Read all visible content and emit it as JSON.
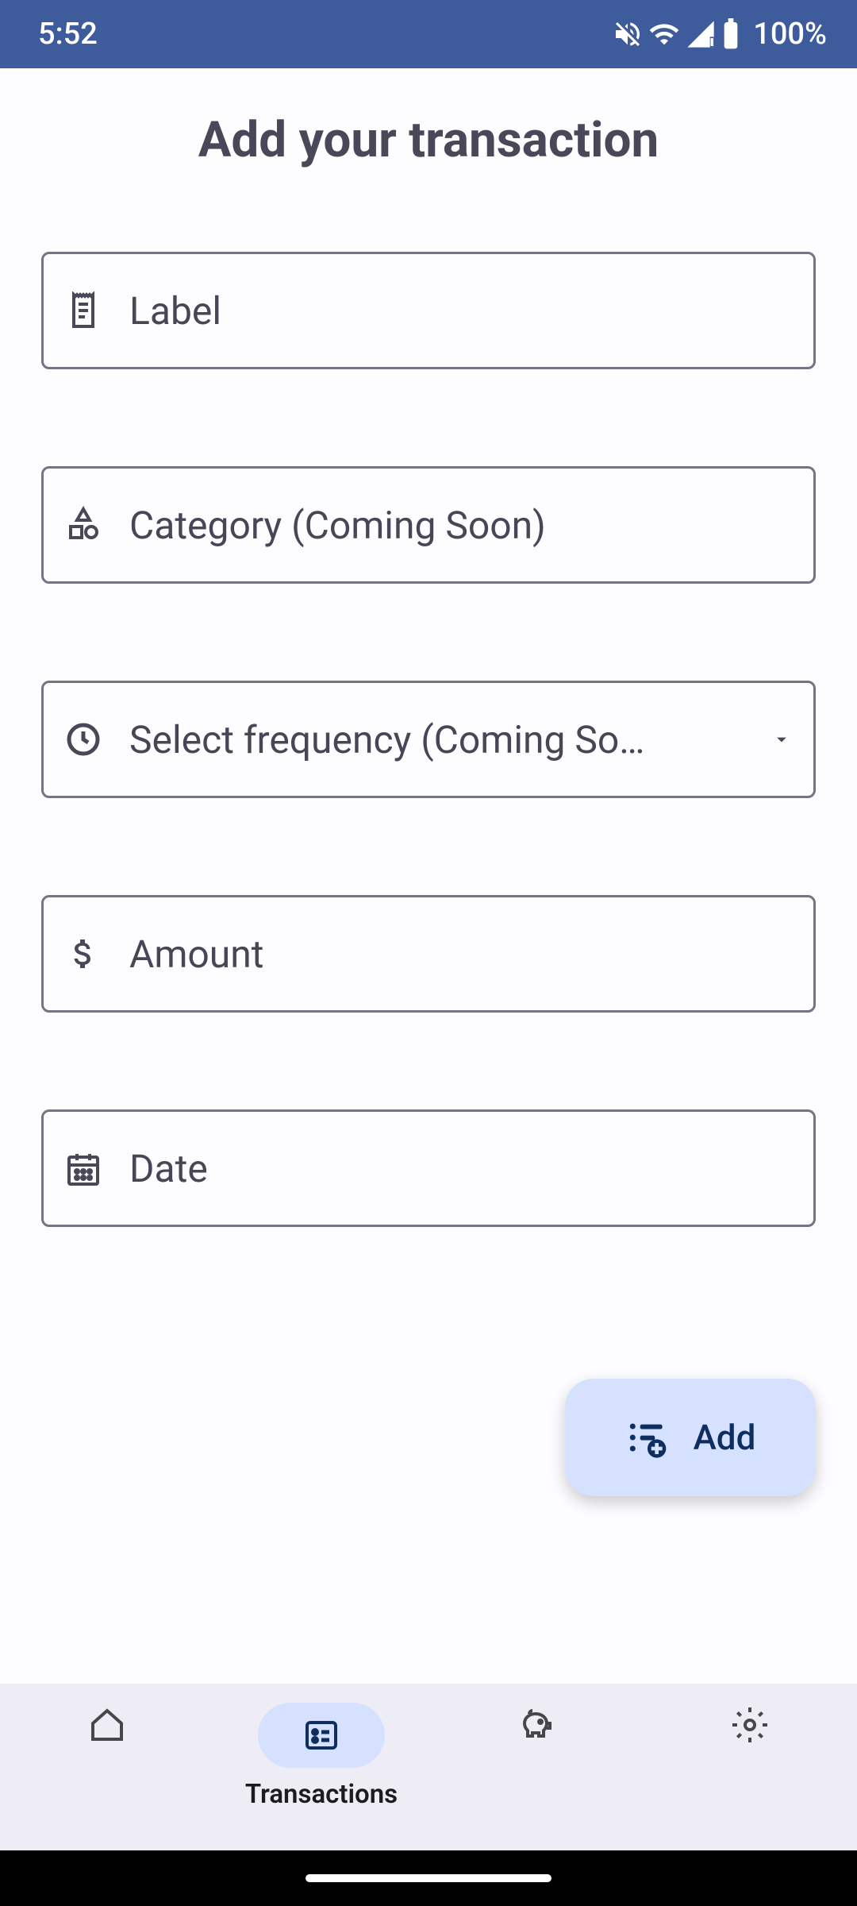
{
  "statusBar": {
    "time": "5:52",
    "battery": "100%"
  },
  "page": {
    "title": "Add your transaction"
  },
  "fields": {
    "label": {
      "placeholder": "Label"
    },
    "category": {
      "placeholder": "Category (Coming Soon)"
    },
    "frequency": {
      "placeholder": "Select frequency (Coming So…"
    },
    "amount": {
      "placeholder": "Amount"
    },
    "date": {
      "placeholder": "Date"
    }
  },
  "addButton": {
    "label": "Add"
  },
  "bottomNav": {
    "transactions": {
      "label": "Transactions"
    }
  }
}
